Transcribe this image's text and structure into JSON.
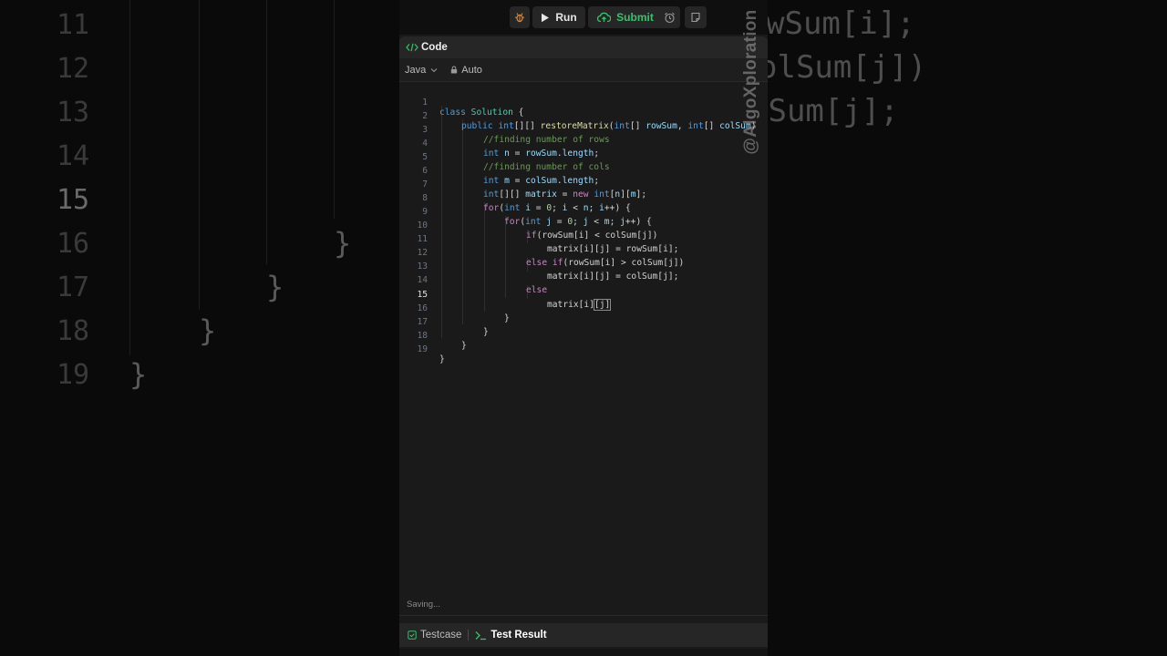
{
  "background": {
    "line_numbers": [
      "11",
      "12",
      "13",
      "14",
      "15",
      "16",
      "17",
      "18",
      "19"
    ],
    "active_line_number": "15",
    "right_fragments": [
      "wSum[i];",
      "olSum[j])",
      "lSum[j];"
    ]
  },
  "toolbar": {
    "run_label": "Run",
    "submit_label": "Submit"
  },
  "code_panel": {
    "title": "Code",
    "language": "Java",
    "mode": "Auto",
    "status": "Saving..."
  },
  "editor": {
    "active_line": "15",
    "lines": [
      {
        "num": "1",
        "text": "class Solution {"
      },
      {
        "num": "2",
        "text": "public int[][] restoreMatrix(int[] rowSum, int[] colSum)"
      },
      {
        "num": "3",
        "text": "//finding number of rows"
      },
      {
        "num": "4",
        "text": "int n = rowSum.length;"
      },
      {
        "num": "5",
        "text": "//finding number of cols"
      },
      {
        "num": "6",
        "text": "int m = colSum.length;"
      },
      {
        "num": "7",
        "text": "int[][] matrix = new int[n][m];"
      },
      {
        "num": "8",
        "text": "for(int i = 0; i < n; i++) {"
      },
      {
        "num": "9",
        "text": "for(int j = 0; j < m; j++) {"
      },
      {
        "num": "10",
        "text": "if(rowSum[i] < colSum[j])"
      },
      {
        "num": "11",
        "text": "matrix[i][j] = rowSum[i];"
      },
      {
        "num": "12",
        "text": "else if(rowSum[i] > colSum[j])"
      },
      {
        "num": "13",
        "text": "matrix[i][j] = colSum[j];"
      },
      {
        "num": "14",
        "text": "else"
      },
      {
        "num": "15",
        "text": "matrix[i][j]"
      },
      {
        "num": "16",
        "text": "}"
      },
      {
        "num": "17",
        "text": "}"
      },
      {
        "num": "18",
        "text": "}"
      },
      {
        "num": "19",
        "text": "}"
      }
    ]
  },
  "bottom_tabs": {
    "testcase": "Testcase",
    "test_result": "Test Result"
  },
  "watermark": "@AlgoXploration",
  "colors": {
    "submit_green": "#33c46b",
    "code_icon_green": "#33c46b",
    "panel_bg": "#1a1a1a"
  }
}
